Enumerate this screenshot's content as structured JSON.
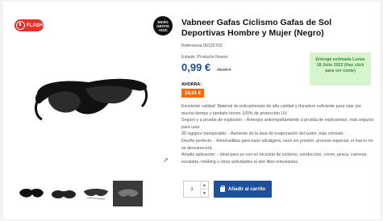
{
  "flash_badge": {
    "label": "FLASH",
    "icon": "clock-icon"
  },
  "shipping_badge": {
    "line1": "ENVÍO",
    "line2": "GRATIS",
    "line3": "+SOC"
  },
  "product": {
    "title": "Vabneer Gafas Ciclismo Gafas de Sol Deportivas Hombre y Mujer (Negro)",
    "reference": "Referencia 00125702",
    "state": "Estado: Producto Nuevo",
    "price": "0,99 €",
    "price_old": "25,00 €",
    "savings_label": "AHORRA:",
    "savings_value": "24,01 €"
  },
  "delivery": {
    "text": "Entrega estimada Lunes 18 Julio 2022 (Haz click para ver coste)"
  },
  "description": [
    "Excelente calidad: Material de policarbonato de alta calidad y duradero suficiente para usar por mucho tiempo y también tienen 100% de protección UV.",
    "Seguro y a prueba de explosión: - Anteojos antiempañamiento a prueba de explosiones, más seguros para usar.",
    "3D agujero transpirable: - Aumento de la tasa de evaporación del sudor, más cómodo.",
    "Diseño perfecto: - Almohadillas para nariz ultraligera, nariz sin presión, proceso especial, el marco no se desvanecerá.",
    "Amplia aplicación: - Ideal para su uso en bicicleta de ciclismo, conducción, correr, pesca, carreras, escalada, trekking u otras actividades al aire libre entusiastas."
  ],
  "cart": {
    "quantity": "1",
    "add_label": "Añadir al carrito",
    "up": "▲",
    "down": "▼"
  },
  "gallery": {
    "zoom_icon": "↗"
  },
  "colors": {
    "accent": "#1c4f9c",
    "flash": "#e8302b",
    "savings": "#ff6b00",
    "delivery_bg": "#d6f5cf",
    "delivery_text": "#3a8a2f"
  }
}
